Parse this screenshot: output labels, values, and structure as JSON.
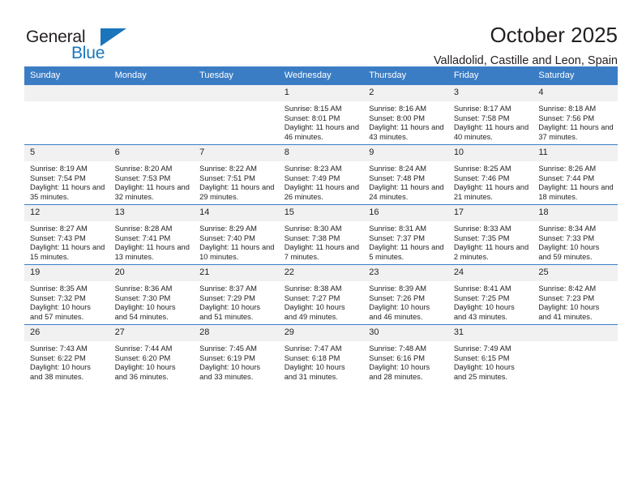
{
  "brand": {
    "name_top": "General",
    "name_bottom": "Blue",
    "accent_color": "#1b75bb",
    "triangle_icon": "brand-triangle-icon"
  },
  "header": {
    "title": "October 2025",
    "subtitle": "Valladolid, Castille and Leon, Spain"
  },
  "colors": {
    "header_row_bg": "#3b7dc4",
    "daynum_bg": "#f1f1f1",
    "text": "#231f20",
    "grid_line": "#3b7dc4"
  },
  "weekdays": [
    "Sunday",
    "Monday",
    "Tuesday",
    "Wednesday",
    "Thursday",
    "Friday",
    "Saturday"
  ],
  "weeks": [
    [
      {
        "day": "",
        "blank": true
      },
      {
        "day": "",
        "blank": true
      },
      {
        "day": "",
        "blank": true
      },
      {
        "day": "1",
        "sunrise": "Sunrise: 8:15 AM",
        "sunset": "Sunset: 8:01 PM",
        "daylight": "Daylight: 11 hours and 46 minutes."
      },
      {
        "day": "2",
        "sunrise": "Sunrise: 8:16 AM",
        "sunset": "Sunset: 8:00 PM",
        "daylight": "Daylight: 11 hours and 43 minutes."
      },
      {
        "day": "3",
        "sunrise": "Sunrise: 8:17 AM",
        "sunset": "Sunset: 7:58 PM",
        "daylight": "Daylight: 11 hours and 40 minutes."
      },
      {
        "day": "4",
        "sunrise": "Sunrise: 8:18 AM",
        "sunset": "Sunset: 7:56 PM",
        "daylight": "Daylight: 11 hours and 37 minutes."
      }
    ],
    [
      {
        "day": "5",
        "sunrise": "Sunrise: 8:19 AM",
        "sunset": "Sunset: 7:54 PM",
        "daylight": "Daylight: 11 hours and 35 minutes."
      },
      {
        "day": "6",
        "sunrise": "Sunrise: 8:20 AM",
        "sunset": "Sunset: 7:53 PM",
        "daylight": "Daylight: 11 hours and 32 minutes."
      },
      {
        "day": "7",
        "sunrise": "Sunrise: 8:22 AM",
        "sunset": "Sunset: 7:51 PM",
        "daylight": "Daylight: 11 hours and 29 minutes."
      },
      {
        "day": "8",
        "sunrise": "Sunrise: 8:23 AM",
        "sunset": "Sunset: 7:49 PM",
        "daylight": "Daylight: 11 hours and 26 minutes."
      },
      {
        "day": "9",
        "sunrise": "Sunrise: 8:24 AM",
        "sunset": "Sunset: 7:48 PM",
        "daylight": "Daylight: 11 hours and 24 minutes."
      },
      {
        "day": "10",
        "sunrise": "Sunrise: 8:25 AM",
        "sunset": "Sunset: 7:46 PM",
        "daylight": "Daylight: 11 hours and 21 minutes."
      },
      {
        "day": "11",
        "sunrise": "Sunrise: 8:26 AM",
        "sunset": "Sunset: 7:44 PM",
        "daylight": "Daylight: 11 hours and 18 minutes."
      }
    ],
    [
      {
        "day": "12",
        "sunrise": "Sunrise: 8:27 AM",
        "sunset": "Sunset: 7:43 PM",
        "daylight": "Daylight: 11 hours and 15 minutes."
      },
      {
        "day": "13",
        "sunrise": "Sunrise: 8:28 AM",
        "sunset": "Sunset: 7:41 PM",
        "daylight": "Daylight: 11 hours and 13 minutes."
      },
      {
        "day": "14",
        "sunrise": "Sunrise: 8:29 AM",
        "sunset": "Sunset: 7:40 PM",
        "daylight": "Daylight: 11 hours and 10 minutes."
      },
      {
        "day": "15",
        "sunrise": "Sunrise: 8:30 AM",
        "sunset": "Sunset: 7:38 PM",
        "daylight": "Daylight: 11 hours and 7 minutes."
      },
      {
        "day": "16",
        "sunrise": "Sunrise: 8:31 AM",
        "sunset": "Sunset: 7:37 PM",
        "daylight": "Daylight: 11 hours and 5 minutes."
      },
      {
        "day": "17",
        "sunrise": "Sunrise: 8:33 AM",
        "sunset": "Sunset: 7:35 PM",
        "daylight": "Daylight: 11 hours and 2 minutes."
      },
      {
        "day": "18",
        "sunrise": "Sunrise: 8:34 AM",
        "sunset": "Sunset: 7:33 PM",
        "daylight": "Daylight: 10 hours and 59 minutes."
      }
    ],
    [
      {
        "day": "19",
        "sunrise": "Sunrise: 8:35 AM",
        "sunset": "Sunset: 7:32 PM",
        "daylight": "Daylight: 10 hours and 57 minutes."
      },
      {
        "day": "20",
        "sunrise": "Sunrise: 8:36 AM",
        "sunset": "Sunset: 7:30 PM",
        "daylight": "Daylight: 10 hours and 54 minutes."
      },
      {
        "day": "21",
        "sunrise": "Sunrise: 8:37 AM",
        "sunset": "Sunset: 7:29 PM",
        "daylight": "Daylight: 10 hours and 51 minutes."
      },
      {
        "day": "22",
        "sunrise": "Sunrise: 8:38 AM",
        "sunset": "Sunset: 7:27 PM",
        "daylight": "Daylight: 10 hours and 49 minutes."
      },
      {
        "day": "23",
        "sunrise": "Sunrise: 8:39 AM",
        "sunset": "Sunset: 7:26 PM",
        "daylight": "Daylight: 10 hours and 46 minutes."
      },
      {
        "day": "24",
        "sunrise": "Sunrise: 8:41 AM",
        "sunset": "Sunset: 7:25 PM",
        "daylight": "Daylight: 10 hours and 43 minutes."
      },
      {
        "day": "25",
        "sunrise": "Sunrise: 8:42 AM",
        "sunset": "Sunset: 7:23 PM",
        "daylight": "Daylight: 10 hours and 41 minutes."
      }
    ],
    [
      {
        "day": "26",
        "sunrise": "Sunrise: 7:43 AM",
        "sunset": "Sunset: 6:22 PM",
        "daylight": "Daylight: 10 hours and 38 minutes."
      },
      {
        "day": "27",
        "sunrise": "Sunrise: 7:44 AM",
        "sunset": "Sunset: 6:20 PM",
        "daylight": "Daylight: 10 hours and 36 minutes."
      },
      {
        "day": "28",
        "sunrise": "Sunrise: 7:45 AM",
        "sunset": "Sunset: 6:19 PM",
        "daylight": "Daylight: 10 hours and 33 minutes."
      },
      {
        "day": "29",
        "sunrise": "Sunrise: 7:47 AM",
        "sunset": "Sunset: 6:18 PM",
        "daylight": "Daylight: 10 hours and 31 minutes."
      },
      {
        "day": "30",
        "sunrise": "Sunrise: 7:48 AM",
        "sunset": "Sunset: 6:16 PM",
        "daylight": "Daylight: 10 hours and 28 minutes."
      },
      {
        "day": "31",
        "sunrise": "Sunrise: 7:49 AM",
        "sunset": "Sunset: 6:15 PM",
        "daylight": "Daylight: 10 hours and 25 minutes."
      },
      {
        "day": "",
        "blank": true
      }
    ]
  ]
}
